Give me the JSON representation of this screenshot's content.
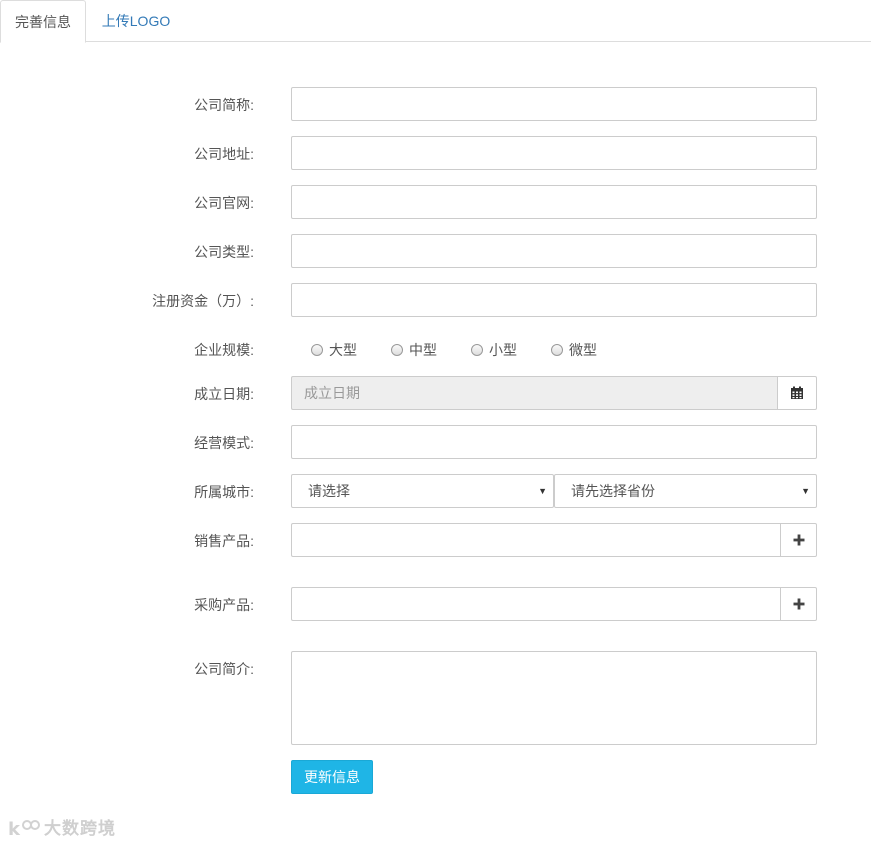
{
  "tabs": [
    {
      "label": "完善信息",
      "active": true
    },
    {
      "label": "上传LOGO",
      "active": false
    }
  ],
  "form": {
    "short_name_label": "公司简称:",
    "address_label": "公司地址:",
    "website_label": "公司官网:",
    "type_label": "公司类型:",
    "capital_label": "注册资金（万）:",
    "scale_label": "企业规模:",
    "scale_options": [
      "大型",
      "中型",
      "小型",
      "微型"
    ],
    "founded_label": "成立日期:",
    "founded_placeholder": "成立日期",
    "business_model_label": "经营模式:",
    "city_label": "所属城市:",
    "province_select": "请选择",
    "city_select": "请先选择省份",
    "sell_products_label": "销售产品:",
    "buy_products_label": "采购产品:",
    "intro_label": "公司简介:",
    "submit_label": "更新信息"
  },
  "icons": {
    "calendar": "calendar-icon",
    "plus": "plus-icon",
    "caret": "caret-down-icon"
  },
  "watermark": {
    "text": "大数跨境"
  },
  "colors": {
    "primary_button": "#1fb5e6",
    "tab_link": "#337ab7"
  }
}
